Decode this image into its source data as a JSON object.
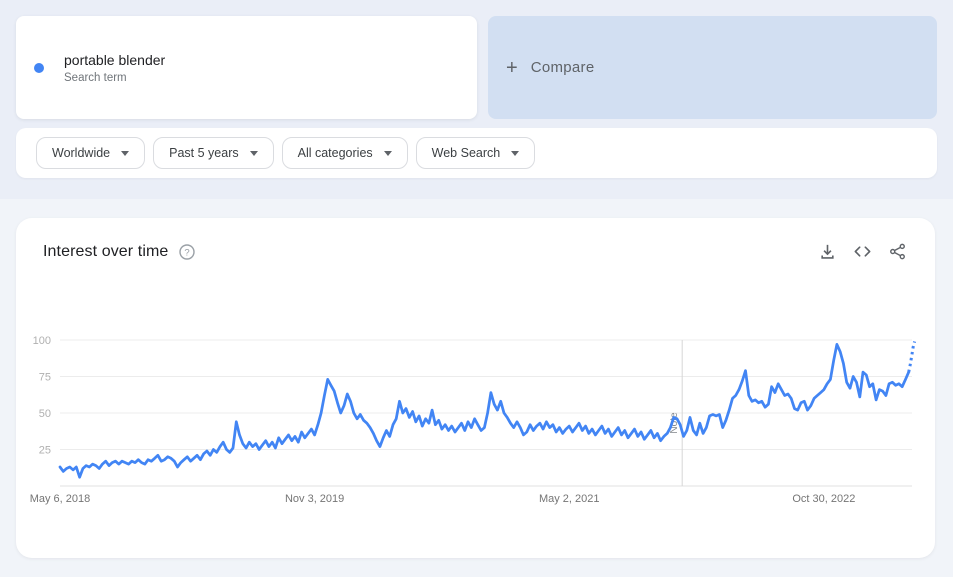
{
  "colors": {
    "accent_blue": "#4285f4",
    "compare_card_bg": "#d2dff2",
    "top_section_bg": "#eaeef7",
    "page_bg": "#f1f4f9",
    "icon_gray": "#5f6368"
  },
  "icons": {
    "series_marker": "filled-circle",
    "compare_plus": "+",
    "dropdown_caret": "triangle-down",
    "help": "circled-question-mark",
    "download": "download-tray-arrow",
    "embed": "angle-brackets",
    "share": "share-nodes"
  },
  "search_card": {
    "term": "portable blender",
    "subtitle": "Search term"
  },
  "compare_card": {
    "label": "Compare"
  },
  "filters": [
    {
      "label": "Worldwide"
    },
    {
      "label": "Past 5 years"
    },
    {
      "label": "All categories"
    },
    {
      "label": "Web Search"
    }
  ],
  "chart_data": {
    "type": "line",
    "title": "Interest over time",
    "series_name": "portable blender",
    "color": "#4285f4",
    "ylim": [
      0,
      100
    ],
    "yticks": [
      25,
      50,
      75,
      100
    ],
    "grid": true,
    "xticks": [
      {
        "label": "May 6, 2018",
        "week_index": 0
      },
      {
        "label": "Nov 3, 2019",
        "week_index": 78
      },
      {
        "label": "May 2, 2021",
        "week_index": 156
      },
      {
        "label": "Oct 30, 2022",
        "week_index": 234
      }
    ],
    "note": {
      "label": "Note",
      "week_index": 190.6
    },
    "values": [
      13,
      10,
      12,
      13,
      11,
      13,
      6,
      12,
      14,
      13,
      15,
      14,
      12,
      15,
      17,
      14,
      16,
      17,
      15,
      17,
      16,
      15,
      17,
      16,
      18,
      16,
      15,
      18,
      17,
      19,
      21,
      17,
      18,
      20,
      19,
      17,
      13,
      16,
      18,
      20,
      17,
      19,
      21,
      18,
      22,
      24,
      21,
      25,
      23,
      27,
      30,
      25,
      23,
      26,
      44,
      35,
      29,
      26,
      30,
      27,
      29,
      25,
      28,
      31,
      27,
      30,
      26,
      33,
      29,
      32,
      35,
      31,
      34,
      30,
      37,
      33,
      36,
      39,
      35,
      42,
      50,
      62,
      73,
      69,
      65,
      57,
      50,
      55,
      63,
      58,
      50,
      46,
      49,
      45,
      43,
      40,
      36,
      31,
      27,
      33,
      38,
      34,
      42,
      46,
      58,
      50,
      53,
      47,
      51,
      44,
      48,
      41,
      46,
      43,
      52,
      42,
      45,
      39,
      42,
      38,
      41,
      37,
      40,
      43,
      38,
      44,
      40,
      46,
      42,
      38,
      40,
      50,
      64,
      56,
      52,
      58,
      50,
      47,
      43,
      40,
      44,
      40,
      35,
      37,
      42,
      38,
      41,
      43,
      39,
      44,
      40,
      42,
      37,
      40,
      36,
      39,
      41,
      37,
      40,
      43,
      38,
      41,
      36,
      39,
      35,
      38,
      41,
      36,
      39,
      34,
      37,
      40,
      35,
      38,
      33,
      36,
      39,
      34,
      37,
      32,
      35,
      38,
      33,
      36,
      31,
      34,
      36,
      40,
      47,
      46,
      42,
      34,
      38,
      47,
      38,
      35,
      43,
      36,
      40,
      48,
      49,
      48,
      49,
      40,
      45,
      52,
      60,
      62,
      66,
      72,
      79,
      62,
      58,
      59,
      57,
      58,
      54,
      56,
      68,
      64,
      70,
      66,
      62,
      63,
      60,
      53,
      52,
      57,
      58,
      52,
      55,
      60,
      62,
      64,
      66,
      70,
      73,
      86,
      97,
      92,
      84,
      71,
      67,
      75,
      71,
      61,
      78,
      76,
      68,
      70,
      59,
      66,
      65,
      62,
      70,
      71,
      69,
      70,
      68,
      73,
      78
    ],
    "dotted_tail": [
      83,
      89,
      95,
      99
    ]
  }
}
